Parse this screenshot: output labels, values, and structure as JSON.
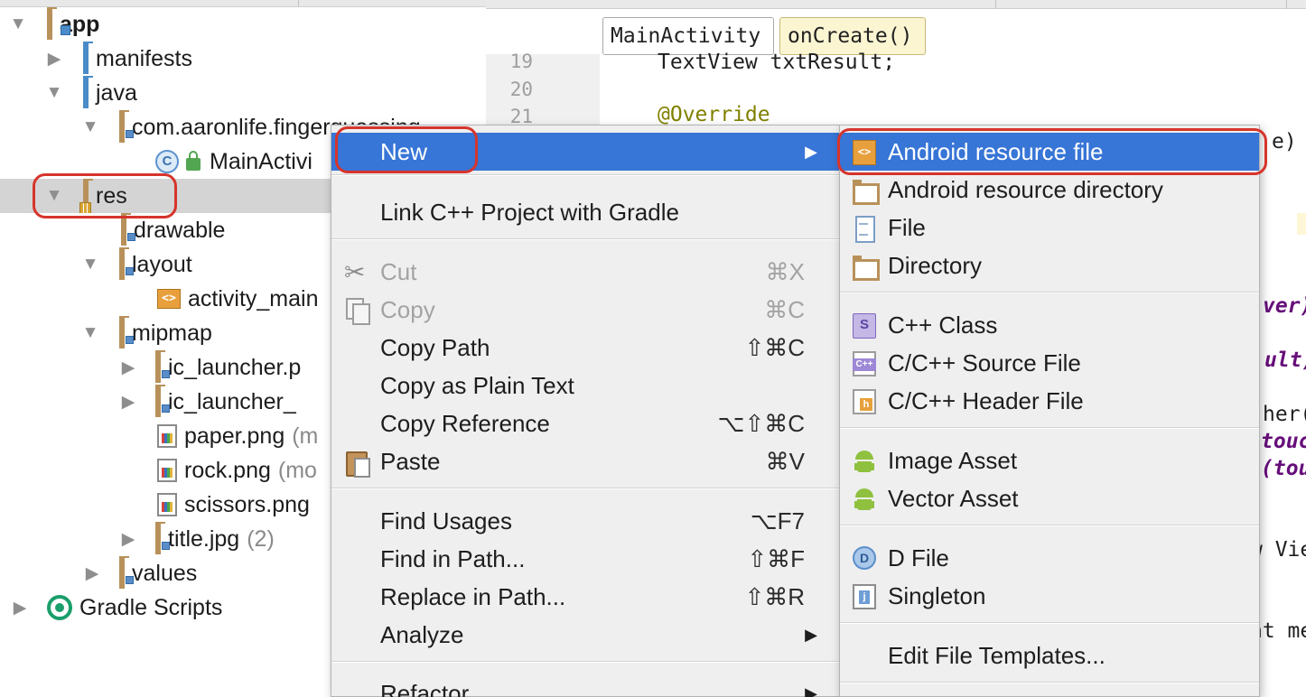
{
  "tree": {
    "items": [
      {
        "label": "app"
      },
      {
        "label": "manifests"
      },
      {
        "label": "java"
      },
      {
        "label": "com.aaronlife.fingerguessing"
      },
      {
        "label": "MainActivi"
      },
      {
        "label": "res"
      },
      {
        "label": "drawable"
      },
      {
        "label": "layout"
      },
      {
        "label": "activity_main"
      },
      {
        "label": "mipmap"
      },
      {
        "label": "ic_launcher.p"
      },
      {
        "label": "ic_launcher_"
      },
      {
        "label": "paper.png",
        "sub": "(m"
      },
      {
        "label": "rock.png",
        "sub": "(mo"
      },
      {
        "label": "scissors.png"
      },
      {
        "label": "title.jpg",
        "sub": "(2)"
      },
      {
        "label": "values"
      },
      {
        "label": "Gradle Scripts"
      }
    ]
  },
  "editor": {
    "breadcrumbs": [
      "MainActivity",
      "onCreate()"
    ],
    "line_numbers": [
      "19",
      "20",
      "21"
    ],
    "code": {
      "line19": "TextView txtResult;",
      "line21": "@Override",
      "frag_e": "e)",
      "frag_ver": "ver)",
      "frag_ult": "ult)",
      "frag_her": "her(",
      "frag_touc": "touc",
      "frag_tou": "(tou",
      "frag_vie": "w Vie",
      "frag_me": "nt me"
    }
  },
  "context_menu": {
    "items": [
      {
        "label": "New",
        "submenu": true
      },
      {
        "label": "Link C++ Project with Gradle"
      },
      {
        "label": "Cut",
        "shortcut": "⌘X"
      },
      {
        "label": "Copy",
        "shortcut": "⌘C"
      },
      {
        "label": "Copy Path",
        "shortcut": "⇧⌘C"
      },
      {
        "label": "Copy as Plain Text"
      },
      {
        "label": "Copy Reference",
        "shortcut": "⌥⇧⌘C"
      },
      {
        "label": "Paste",
        "shortcut": "⌘V"
      },
      {
        "label": "Find Usages",
        "shortcut": "⌥F7"
      },
      {
        "label": "Find in Path...",
        "shortcut": "⇧⌘F"
      },
      {
        "label": "Replace in Path...",
        "shortcut": "⇧⌘R"
      },
      {
        "label": "Analyze",
        "submenu": true
      },
      {
        "label": "Refactor",
        "submenu": true
      }
    ],
    "submenu_arrow": "▶"
  },
  "new_submenu": {
    "items": [
      {
        "label": "Android resource file"
      },
      {
        "label": "Android resource directory"
      },
      {
        "label": "File"
      },
      {
        "label": "Directory"
      },
      {
        "label": "C++ Class"
      },
      {
        "label": "C/C++ Source File"
      },
      {
        "label": "C/C++ Header File"
      },
      {
        "label": "Image Asset"
      },
      {
        "label": "Vector Asset"
      },
      {
        "label": "D File"
      },
      {
        "label": "Singleton"
      },
      {
        "label": "Edit File Templates..."
      }
    ]
  },
  "colors": {
    "selection_blue": "#3775d6",
    "highlight_red": "#d6342c",
    "folder_brown": "#b8915a",
    "folder_blue": "#4a8cc9"
  }
}
